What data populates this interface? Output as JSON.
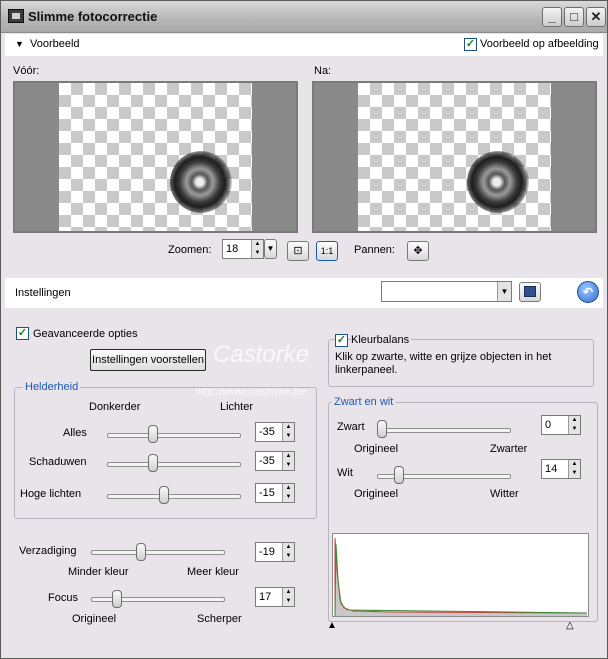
{
  "window": {
    "title": "Slimme fotocorrectie",
    "controls": {
      "minimize": "_",
      "maximize": "□",
      "close": "✕"
    }
  },
  "preview_section": {
    "toggle_label": "Voorbeeld",
    "preview_on_image_label": "Voorbeeld op afbeelding",
    "preview_on_image_checked": true,
    "before_label": "Vóór:",
    "after_label": "Na:",
    "zoom_label": "Zoomen:",
    "zoom_value": "18",
    "pan_label": "Pannen:",
    "one_to_one_label": "1:1"
  },
  "settings_bar": {
    "label": "Instellingen",
    "preset_value": ""
  },
  "advanced": {
    "advanced_options_label": "Geavanceerde opties",
    "advanced_options_checked": true,
    "suggest_button": "Instellingen voorstellen"
  },
  "brightness": {
    "group_title": "Helderheid",
    "darker": "Donkerder",
    "lighter": "Lichter",
    "rows": [
      {
        "label": "Alles",
        "value": "-35",
        "fraction": 0.33
      },
      {
        "label": "Schaduwen",
        "value": "-35",
        "fraction": 0.33
      },
      {
        "label": "Hoge lichten",
        "value": "-15",
        "fraction": 0.42
      }
    ]
  },
  "saturation": {
    "label": "Verzadiging",
    "value": "-19",
    "fraction": 0.36,
    "min_label": "Minder kleur",
    "max_label": "Meer kleur"
  },
  "focus": {
    "label": "Focus",
    "value": "17",
    "fraction": 0.17,
    "min_label": "Origineel",
    "max_label": "Scherper"
  },
  "color_balance": {
    "label": "Kleurbalans",
    "checked": true,
    "hint": "Klik op zwarte, witte en grijze objecten in het linkerpaneel."
  },
  "black_white": {
    "group_title": "Zwart en wit",
    "black": {
      "label": "Zwart",
      "value": "0",
      "fraction": 0.0,
      "min_label": "Origineel",
      "max_label": "Zwarter"
    },
    "white": {
      "label": "Wit",
      "value": "14",
      "fraction": 0.14,
      "min_label": "Origineel",
      "max_label": "Witter"
    }
  },
  "watermark": {
    "name": "Castorke",
    "url": "http://www.castorke.be"
  },
  "colors": {
    "accent_blue": "#1b58b8",
    "window_bg": "#e9e4ea",
    "check_green": "#208020"
  }
}
